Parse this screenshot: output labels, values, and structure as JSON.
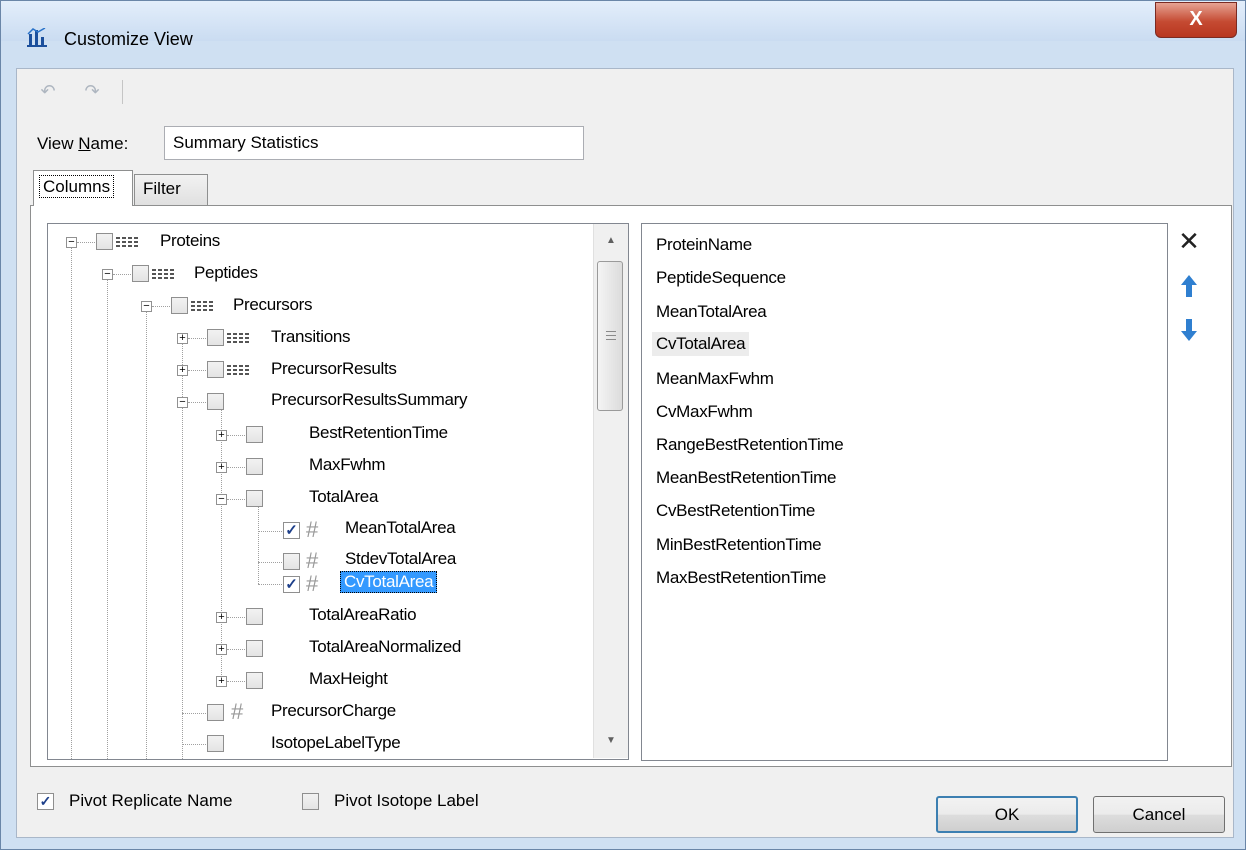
{
  "window": {
    "title": "Customize View",
    "close_glyph": "X"
  },
  "toolbar": {
    "undo_icon": "undo-icon",
    "redo_icon": "redo-icon"
  },
  "view_name": {
    "label_prefix": "View ",
    "label_accel": "N",
    "label_suffix": "ame:",
    "value": "Summary Statistics"
  },
  "tabs": [
    {
      "label": "Columns",
      "active": true
    },
    {
      "label": "Filter",
      "active": false
    }
  ],
  "tree": {
    "nodes": [
      {
        "label": "Proteins",
        "expander": "−",
        "checked": false,
        "icon": "grid"
      },
      {
        "label": "Peptides",
        "expander": "−",
        "checked": false,
        "icon": "grid"
      },
      {
        "label": "Precursors",
        "expander": "−",
        "checked": false,
        "icon": "grid"
      },
      {
        "label": "Transitions",
        "expander": "+",
        "checked": false,
        "icon": "grid"
      },
      {
        "label": "PrecursorResults",
        "expander": "+",
        "checked": false,
        "icon": "grid"
      },
      {
        "label": "PrecursorResultsSummary",
        "expander": "−",
        "checked": false,
        "icon": "none"
      },
      {
        "label": "BestRetentionTime",
        "expander": "+",
        "checked": false,
        "icon": "none"
      },
      {
        "label": "MaxFwhm",
        "expander": "+",
        "checked": false,
        "icon": "none"
      },
      {
        "label": "TotalArea",
        "expander": "−",
        "checked": false,
        "icon": "none"
      },
      {
        "label": "MeanTotalArea",
        "expander": "",
        "checked": true,
        "icon": "hash"
      },
      {
        "label": "StdevTotalArea",
        "expander": "",
        "checked": false,
        "icon": "hash"
      },
      {
        "label": "CvTotalArea",
        "expander": "",
        "checked": true,
        "icon": "hash",
        "selected": true
      },
      {
        "label": "TotalAreaRatio",
        "expander": "+",
        "checked": false,
        "icon": "none"
      },
      {
        "label": "TotalAreaNormalized",
        "expander": "+",
        "checked": false,
        "icon": "none"
      },
      {
        "label": "MaxHeight",
        "expander": "+",
        "checked": false,
        "icon": "none"
      },
      {
        "label": "PrecursorCharge",
        "expander": "",
        "checked": false,
        "icon": "hash"
      },
      {
        "label": "IsotopeLabelType",
        "expander": "",
        "checked": false,
        "icon": "none"
      }
    ],
    "check_glyph": "✓",
    "hash_glyph": "#"
  },
  "selected_columns": [
    "ProteinName",
    "PeptideSequence",
    "MeanTotalArea",
    "CvTotalArea",
    "MeanMaxFwhm",
    "CvMaxFwhm",
    "RangeBestRetentionTime",
    "MeanBestRetentionTime",
    "CvBestRetentionTime",
    "MinBestRetentionTime",
    "MaxBestRetentionTime"
  ],
  "side_buttons": {
    "remove_glyph": "✕",
    "up_glyph": "▲",
    "down_glyph": "▼"
  },
  "footer": {
    "pivot_replicate": {
      "label": "Pivot Replicate Name",
      "checked": true
    },
    "pivot_isotope": {
      "label": "Pivot Isotope Label",
      "checked": false
    },
    "ok_label": "OK",
    "cancel_label": "Cancel"
  },
  "colors": {
    "selection": "#3399ff",
    "arrow_blue": "#2f7fd0",
    "close_red": "#c54a32"
  }
}
